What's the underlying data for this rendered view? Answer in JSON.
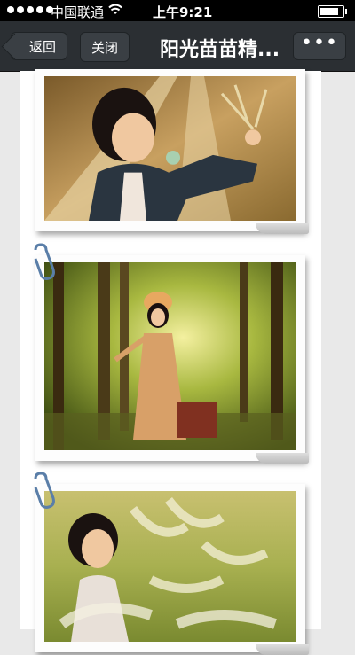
{
  "status_bar": {
    "carrier": "中国联通",
    "time": "上午9:21"
  },
  "nav": {
    "back_label": "返回",
    "close_label": "关闭",
    "title": "阳光苗苗精...",
    "more_label": "•••"
  },
  "photos": [
    {
      "scene": "girl holding grass by railway tracks"
    },
    {
      "scene": "girl in forest with suitcase"
    },
    {
      "scene": "girl in tall grass"
    }
  ],
  "icons": [
    "wifi-icon",
    "battery-icon",
    "paperclip-icon"
  ]
}
